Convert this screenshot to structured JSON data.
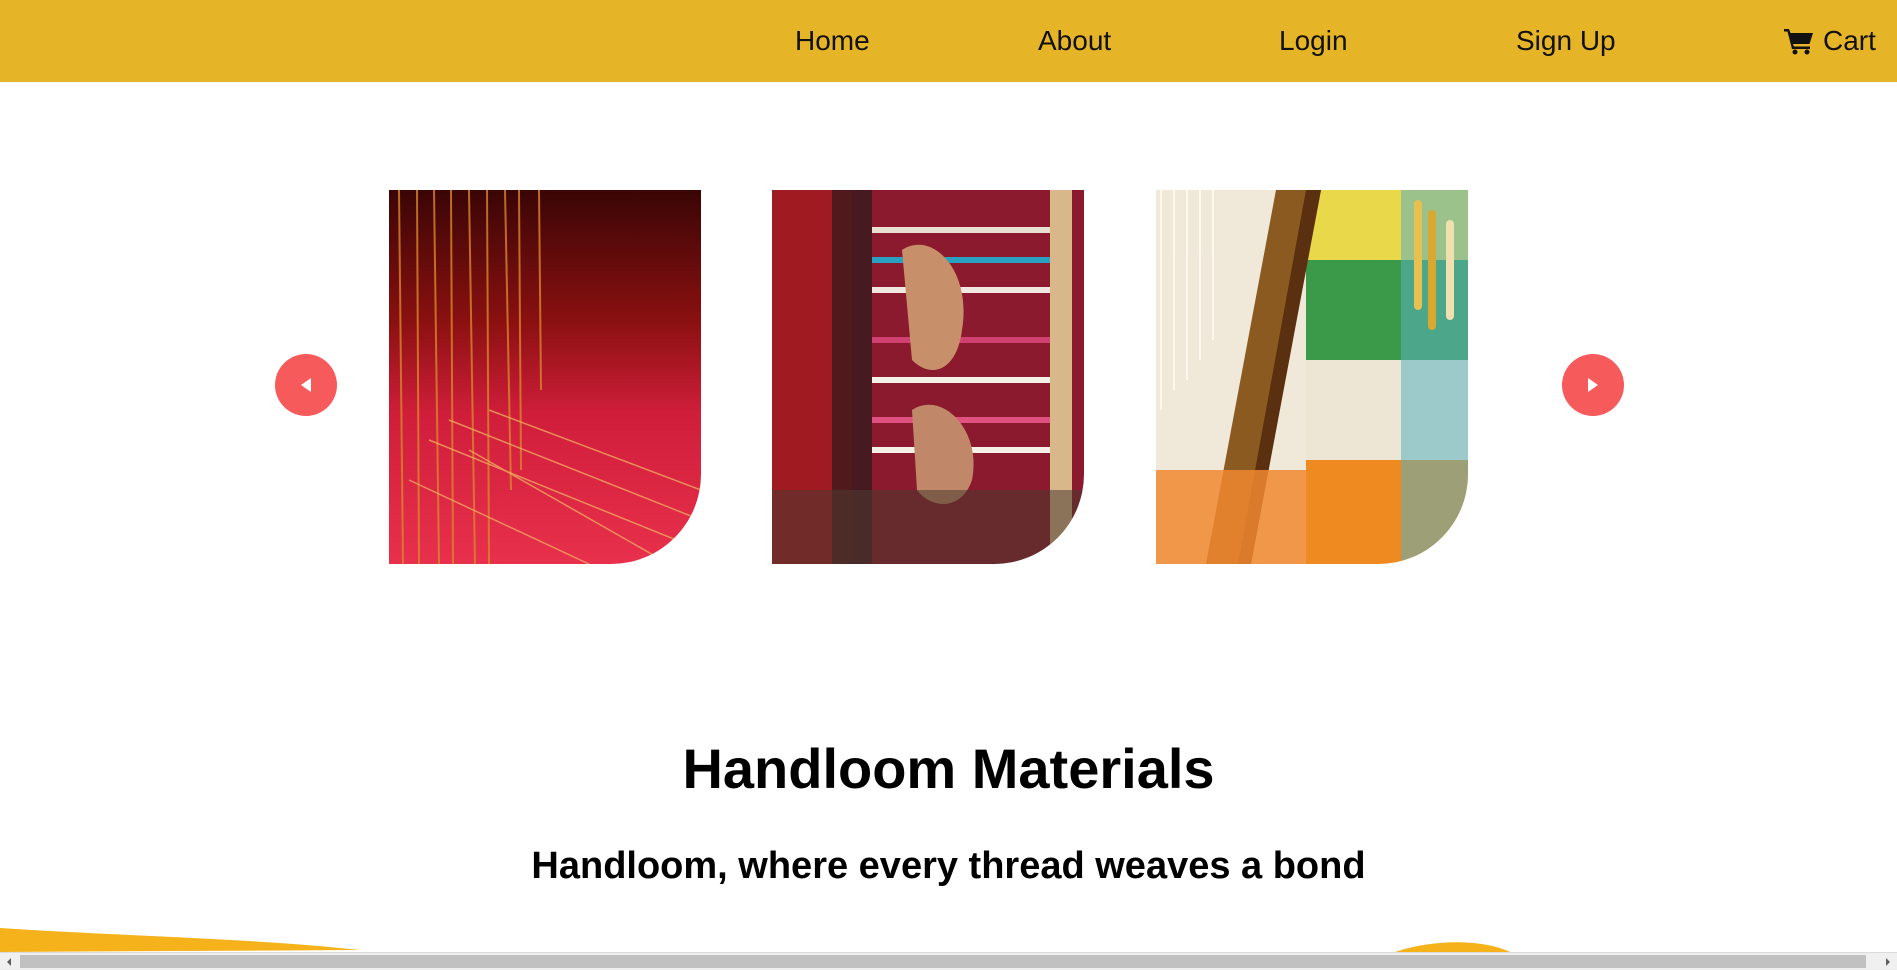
{
  "nav": {
    "items": [
      {
        "label": "Home"
      },
      {
        "label": "About"
      },
      {
        "label": "Login"
      },
      {
        "label": "Sign Up"
      }
    ],
    "cart_label": "Cart",
    "cart_icon": "shopping-cart-icon",
    "bg_color": "#e5b427"
  },
  "carousel": {
    "prev_icon": "caret-left-icon",
    "next_icon": "caret-right-icon",
    "button_color": "#f65a5a",
    "slides": [
      {
        "alt": "red loom threads"
      },
      {
        "alt": "hands weaving striped textile"
      },
      {
        "alt": "colorful loom with yarn spools"
      }
    ]
  },
  "main": {
    "title": "Handloom Materials",
    "subtitle": "Handloom, where every thread weaves a bond"
  }
}
